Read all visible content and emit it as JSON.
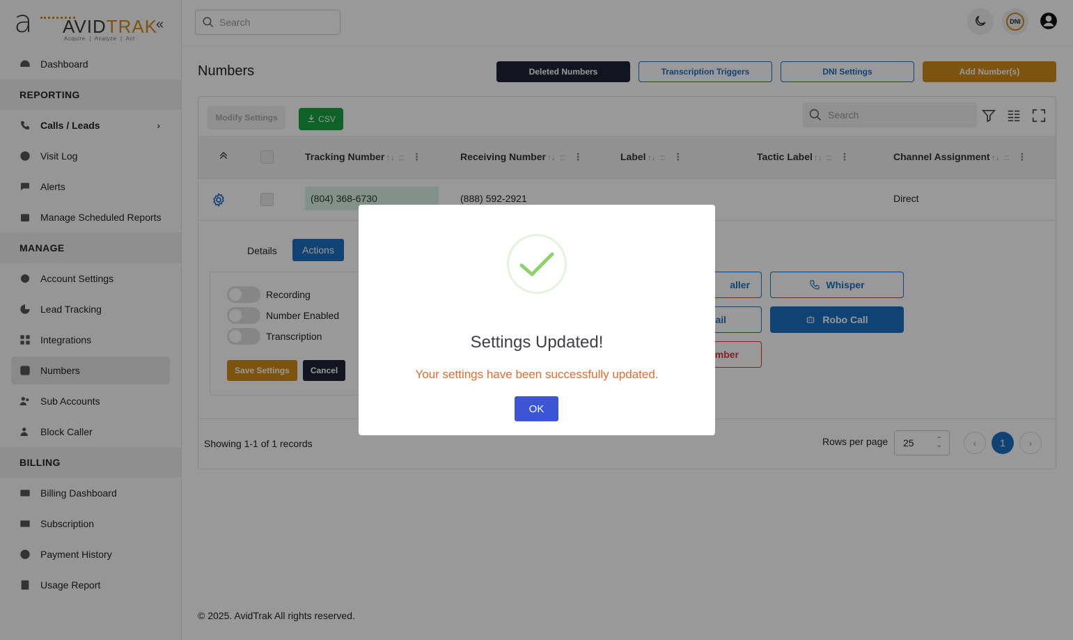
{
  "brand": {
    "logo_letter": "a",
    "logo_avid": "AVID",
    "logo_trak": "TRAK",
    "tagline": "Acquire  |  Analyze  |  Act",
    "collapse_glyph": "«"
  },
  "sidebar": {
    "items": [
      {
        "type": "item",
        "label": "Dashboard",
        "icon": "dashboard-icon"
      },
      {
        "type": "section",
        "label": "REPORTING"
      },
      {
        "type": "item",
        "label": "Calls / Leads",
        "icon": "phone-icon",
        "bold": true,
        "chevron": "›"
      },
      {
        "type": "item",
        "label": "Visit Log",
        "icon": "globe-icon"
      },
      {
        "type": "item",
        "label": "Alerts",
        "icon": "chat-bubble-icon"
      },
      {
        "type": "item",
        "label": "Manage Scheduled Reports",
        "icon": "calendar-icon"
      },
      {
        "type": "section",
        "label": "MANAGE"
      },
      {
        "type": "item",
        "label": "Account Settings",
        "icon": "gear-icon"
      },
      {
        "type": "item",
        "label": "Lead Tracking",
        "icon": "pie-chart-icon"
      },
      {
        "type": "item",
        "label": "Integrations",
        "icon": "grid-plus-icon"
      },
      {
        "type": "item",
        "label": "Numbers",
        "icon": "hash-icon",
        "active": true
      },
      {
        "type": "item",
        "label": "Sub Accounts",
        "icon": "users-icon"
      },
      {
        "type": "item",
        "label": "Block Caller",
        "icon": "user-block-icon"
      },
      {
        "type": "section",
        "label": "BILLING"
      },
      {
        "type": "item",
        "label": "Billing Dashboard",
        "icon": "credit-card-icon"
      },
      {
        "type": "item",
        "label": "Subscription",
        "icon": "card-clock-icon"
      },
      {
        "type": "item",
        "label": "Payment History",
        "icon": "dollar-circle-icon"
      },
      {
        "type": "item",
        "label": "Usage Report",
        "icon": "report-icon"
      }
    ]
  },
  "topbar": {
    "search_placeholder": "Search",
    "dni_badge": "DNI"
  },
  "main": {
    "title": "Numbers",
    "buttons": {
      "deleted": "Deleted Numbers",
      "transcription": "Transcription Triggers",
      "dni_settings": "DNI Settings",
      "add": "Add Number(s)"
    }
  },
  "table": {
    "modify_label": "Modify Settings",
    "csv_label": "CSV",
    "search_placeholder": "Search",
    "columns": [
      "Tracking Number",
      "Receiving Number",
      "Label",
      "Tactic Label",
      "Channel Assignment"
    ],
    "sort_glyph": "↑↓",
    "grip_glyph": ":::",
    "kebab_glyph": "⋮",
    "rows": [
      {
        "tracking": "(804) 368-6730",
        "receiving": "(888) 592-2921",
        "label": "",
        "tactic": "",
        "channel": "Direct"
      }
    ]
  },
  "detail": {
    "tab_details": "Details",
    "tab_actions": "Actions",
    "toggles": [
      "Recording",
      "Number Enabled",
      "Transcription"
    ],
    "save_label": "Save Settings",
    "cancel_label": "Cancel",
    "actions": {
      "caller_partial": "aller",
      "mail_partial": "ail",
      "number_partial": "mber",
      "whisper": "Whisper",
      "robo": "Robo Call"
    }
  },
  "pagination": {
    "showing": "Showing 1-1 of 1 records",
    "rows_per_page_label": "Rows per page",
    "rows_per_page_value": "25",
    "current_page": "1",
    "prev": "‹",
    "next": "›"
  },
  "footer": {
    "copyright": "© 2025. AvidTrak All rights reserved."
  },
  "modal": {
    "title": "Settings Updated!",
    "message": "Your settings have been successfully updated.",
    "ok_label": "OK",
    "check_color": "#8fd16a",
    "message_color": "#e56b2a"
  }
}
